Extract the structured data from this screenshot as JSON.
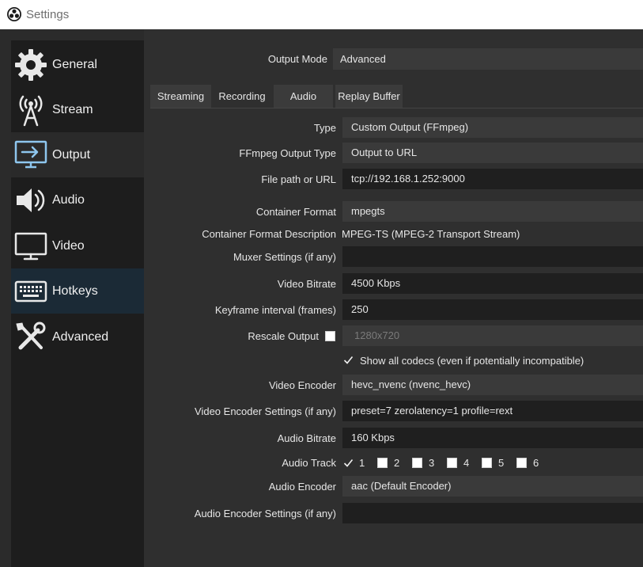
{
  "window": {
    "title": "Settings"
  },
  "sidebar": {
    "items": [
      {
        "label": "General",
        "icon": "gear-icon"
      },
      {
        "label": "Stream",
        "icon": "antenna-icon"
      },
      {
        "label": "Output",
        "icon": "output-icon"
      },
      {
        "label": "Audio",
        "icon": "speaker-icon"
      },
      {
        "label": "Video",
        "icon": "monitor-icon"
      },
      {
        "label": "Hotkeys",
        "icon": "keyboard-icon"
      },
      {
        "label": "Advanced",
        "icon": "tools-icon"
      }
    ],
    "selected": "Output"
  },
  "output_mode": {
    "label": "Output Mode",
    "value": "Advanced"
  },
  "tabs": [
    "Streaming",
    "Recording",
    "Audio",
    "Replay Buffer"
  ],
  "active_tab": "Recording",
  "form": {
    "type": {
      "label": "Type",
      "value": "Custom Output (FFmpeg)"
    },
    "ffmpeg_output_type": {
      "label": "FFmpeg Output Type",
      "value": "Output to URL"
    },
    "file_path": {
      "label": "File path or URL",
      "value": "tcp://192.168.1.252:9000"
    },
    "container_format": {
      "label": "Container Format",
      "value": "mpegts"
    },
    "container_format_desc": {
      "label": "Container Format Description",
      "value": "MPEG-TS (MPEG-2 Transport Stream)"
    },
    "muxer_settings": {
      "label": "Muxer Settings (if any)",
      "value": ""
    },
    "video_bitrate": {
      "label": "Video Bitrate",
      "value": "4500 Kbps"
    },
    "keyframe_interval": {
      "label": "Keyframe interval (frames)",
      "value": "250"
    },
    "rescale_output": {
      "label": "Rescale Output",
      "checked": false,
      "value": "1280x720"
    },
    "show_all_codecs": {
      "label": "Show all codecs (even if potentially incompatible)",
      "checked": true
    },
    "video_encoder": {
      "label": "Video Encoder",
      "value": "hevc_nvenc (nvenc_hevc)"
    },
    "video_encoder_settings": {
      "label": "Video Encoder Settings (if any)",
      "value": "preset=7 zerolatency=1 profile=rext"
    },
    "audio_bitrate": {
      "label": "Audio Bitrate",
      "value": "160 Kbps"
    },
    "audio_track": {
      "label": "Audio Track",
      "tracks": [
        {
          "label": "1",
          "checked": true
        },
        {
          "label": "2",
          "checked": false
        },
        {
          "label": "3",
          "checked": false
        },
        {
          "label": "4",
          "checked": false
        },
        {
          "label": "5",
          "checked": false
        },
        {
          "label": "6",
          "checked": false
        }
      ]
    },
    "audio_encoder": {
      "label": "Audio Encoder",
      "value": "aac (Default Encoder)"
    },
    "audio_encoder_settings": {
      "label": "Audio Encoder Settings (if any)",
      "value": ""
    }
  },
  "colors": {
    "sidebar_bg": "#1d1d1d",
    "main_bg": "#2f2f2f",
    "hover_bg": "#1b2a36",
    "combo_bg": "#3a3a3a",
    "edit_bg": "#1f1f1f"
  }
}
